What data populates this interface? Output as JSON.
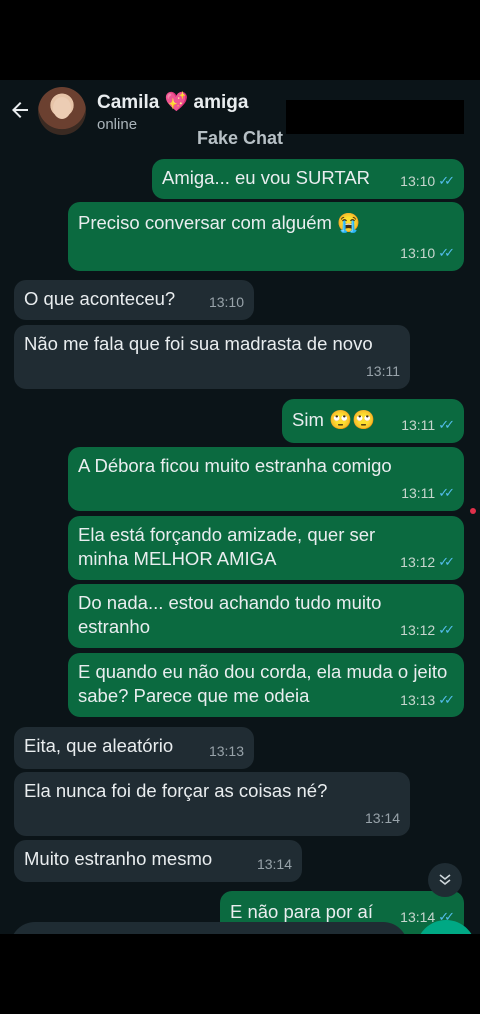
{
  "header": {
    "back_icon": "arrow-left-icon",
    "contact_name": "Camila 💖 amiga",
    "status": "online",
    "watermark": "Fake Chat"
  },
  "messages": [
    {
      "dir": "out",
      "text": "Amiga... eu vou SURTAR",
      "time": "13:10",
      "read": true
    },
    {
      "dir": "out",
      "text": "Preciso conversar com alguém 😭",
      "time": "13:10",
      "read": true
    },
    {
      "dir": "in",
      "text": "O que aconteceu?",
      "time": "13:10"
    },
    {
      "dir": "in",
      "text": "Não me fala que foi sua madrasta de novo",
      "time": "13:11"
    },
    {
      "dir": "out",
      "text": "Sim 🙄🙄",
      "time": "13:11",
      "read": true
    },
    {
      "dir": "out",
      "text": "A Débora ficou muito estranha comigo",
      "time": "13:11",
      "read": true
    },
    {
      "dir": "out",
      "text": "Ela está forçando amizade, quer ser minha MELHOR AMIGA",
      "time": "13:12",
      "read": true
    },
    {
      "dir": "out",
      "text": "Do nada... estou achando tudo muito estranho",
      "time": "13:12",
      "read": true
    },
    {
      "dir": "out",
      "text": "E quando eu não dou corda, ela muda o jeito sabe? Parece que me odeia",
      "time": "13:13",
      "read": true
    },
    {
      "dir": "in",
      "text": "Eita, que aleatório",
      "time": "13:13"
    },
    {
      "dir": "in",
      "text": "Ela nunca foi de forçar as coisas né?",
      "time": "13:14"
    },
    {
      "dir": "in",
      "text": "Muito estranho mesmo",
      "time": "13:14"
    },
    {
      "dir": "out",
      "text": "E não para por aí",
      "time": "13:14",
      "read": true
    }
  ],
  "icons": {
    "scroll_down": "double-chevron-down-icon",
    "read_receipt": "double-check-icon"
  },
  "colors": {
    "outgoing_bubble": "#0b6a40",
    "incoming_bubble": "#202c33",
    "read_ticks": "#53bdeb",
    "background": "#0b1418"
  }
}
